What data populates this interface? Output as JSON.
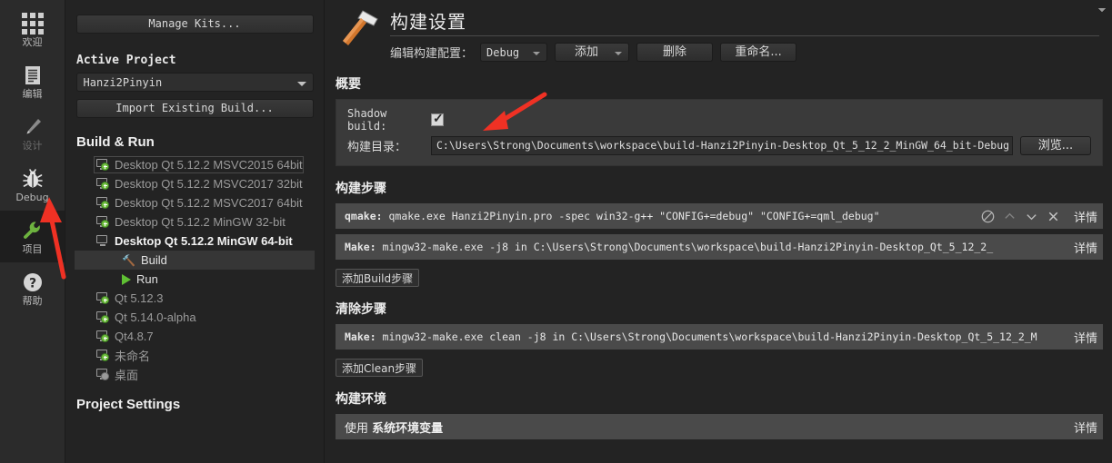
{
  "modebar": {
    "items": [
      {
        "label": "欢迎",
        "icon": "grid-icon",
        "state": "normal"
      },
      {
        "label": "编辑",
        "icon": "document-icon",
        "state": "normal"
      },
      {
        "label": "设计",
        "icon": "pencil-icon",
        "state": "dim"
      },
      {
        "label": "Debug",
        "icon": "bug-icon",
        "state": "normal"
      },
      {
        "label": "项目",
        "icon": "wrench-icon",
        "state": "active"
      },
      {
        "label": "帮助",
        "icon": "question-icon",
        "state": "normal"
      }
    ]
  },
  "tree": {
    "manage_kits_label": "Manage Kits...",
    "active_project_heading": "Active Project",
    "active_project_value": "Hanzi2Pinyin",
    "import_existing_label": "Import Existing Build...",
    "build_run_heading": "Build & Run",
    "project_settings_heading": "Project Settings",
    "kits": [
      {
        "label": "Desktop Qt 5.12.2 MSVC2015 64bit",
        "icon": "kit-add-icon",
        "style": "dim-outline"
      },
      {
        "label": "Desktop Qt 5.12.2 MSVC2017 32bit",
        "icon": "kit-add-icon",
        "style": "dim"
      },
      {
        "label": "Desktop Qt 5.12.2 MSVC2017 64bit",
        "icon": "kit-add-icon",
        "style": "dim"
      },
      {
        "label": "Desktop Qt 5.12.2 MinGW 32-bit",
        "icon": "kit-add-icon",
        "style": "dim"
      },
      {
        "label": "Desktop Qt 5.12.2 MinGW 64-bit",
        "icon": "monitor-icon",
        "style": "active-bold"
      },
      {
        "label": "Build",
        "icon": "hammer-icon",
        "style": "sub-selected"
      },
      {
        "label": "Run",
        "icon": "play-icon",
        "style": "sub"
      },
      {
        "label": "Qt 5.12.3",
        "icon": "kit-add-icon",
        "style": "dim"
      },
      {
        "label": "Qt 5.14.0-alpha",
        "icon": "kit-add-icon",
        "style": "dim"
      },
      {
        "label": "Qt4.8.7",
        "icon": "kit-add-icon",
        "style": "dim"
      },
      {
        "label": "未命名",
        "icon": "kit-add-icon",
        "style": "dim"
      },
      {
        "label": "桌面",
        "icon": "kit-warn-icon",
        "style": "dim"
      }
    ]
  },
  "main": {
    "page_title": "构建设置",
    "edit_config_label": "编辑构建配置：",
    "config_value": "Debug",
    "add_button": "添加",
    "delete_button": "删除",
    "rename_button": "重命名...",
    "summary_heading": "概要",
    "shadow_build_label": "Shadow build:",
    "shadow_build_checked": true,
    "build_dir_label": "构建目录：",
    "build_dir_value": "C:\\Users\\Strong\\Documents\\workspace\\build-Hanzi2Pinyin-Desktop_Qt_5_12_2_MinGW_64_bit-Debug",
    "browse_button": "浏览...",
    "build_steps_heading": "构建步骤",
    "build_steps": [
      {
        "name": "qmake:",
        "command": " qmake.exe Hanzi2Pinyin.pro -spec win32-g++ \"CONFIG+=debug\" \"CONFIG+=qml_debug\"",
        "details_label": "详情",
        "icons": [
          "disable-icon",
          "move-up-icon",
          "move-down-icon",
          "remove-icon"
        ]
      },
      {
        "name": "Make:",
        "command": " mingw32-make.exe -j8 in C:\\Users\\Strong\\Documents\\workspace\\build-Hanzi2Pinyin-Desktop_Qt_5_12_2_",
        "details_label": "详情",
        "icons": []
      }
    ],
    "add_build_step_label": "添加Build步骤",
    "clean_steps_heading": "清除步骤",
    "clean_steps": [
      {
        "name": "Make:",
        "command": " mingw32-make.exe clean -j8 in C:\\Users\\Strong\\Documents\\workspace\\build-Hanzi2Pinyin-Desktop_Qt_5_12_2_M",
        "details_label": "详情",
        "icons": []
      }
    ],
    "add_clean_step_label": "添加Clean步骤",
    "build_env_heading": "构建环境",
    "build_env_prefix": "使用",
    "build_env_value": "系统环境变量",
    "build_env_details_label": "详情"
  },
  "colors": {
    "background": "#232323",
    "panel": "#3a3a3a",
    "step_row": "#4a4a4a",
    "annotation_arrow": "#ef3124",
    "kit_add": "#6fbf3f",
    "hammer": "#d9883a"
  }
}
